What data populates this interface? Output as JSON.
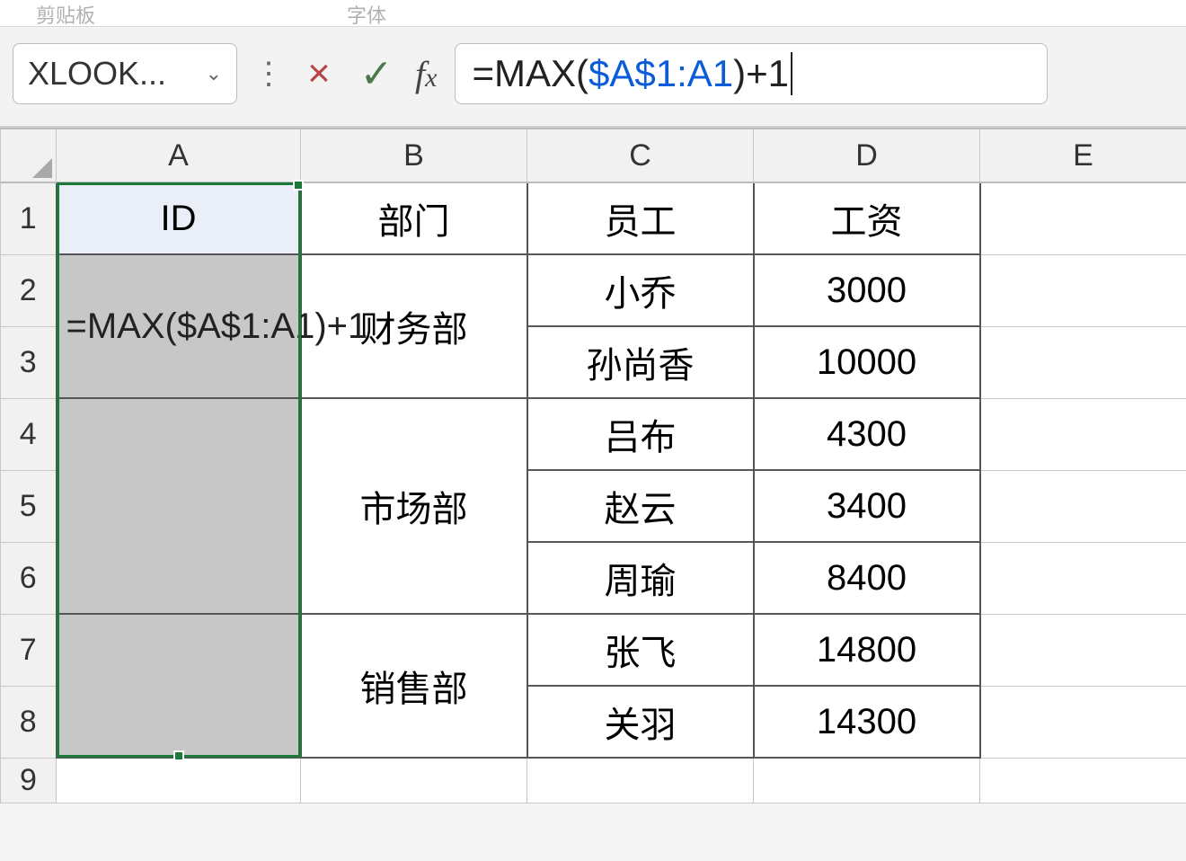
{
  "ribbon": {
    "left_hint": "剪贴板",
    "right_hint": "字体"
  },
  "nameBox": {
    "value": "XLOOK..."
  },
  "formulaBar": {
    "prefix": "=MAX(",
    "ref": "$A$1:A1",
    "suffix": ")+1"
  },
  "columns": {
    "A": "A",
    "B": "B",
    "C": "C",
    "D": "D",
    "E": "E"
  },
  "rows": [
    "1",
    "2",
    "3",
    "4",
    "5",
    "6",
    "7",
    "8",
    "9"
  ],
  "headers": {
    "A": "ID",
    "B": "部门",
    "C": "员工",
    "D": "工资"
  },
  "editingCellText": "=MAX($A$1:A1)+1",
  "departments": {
    "r2_3": "财务部",
    "r4_6": "市场部",
    "r7_8": "销售部"
  },
  "data": {
    "C2": "小乔",
    "D2": "3000",
    "C3": "孙尚香",
    "D3": "10000",
    "C4": "吕布",
    "D4": "4300",
    "C5": "赵云",
    "D5": "3400",
    "C6": "周瑜",
    "D6": "8400",
    "C7": "张飞",
    "D7": "14800",
    "C8": "关羽",
    "D8": "14300"
  }
}
